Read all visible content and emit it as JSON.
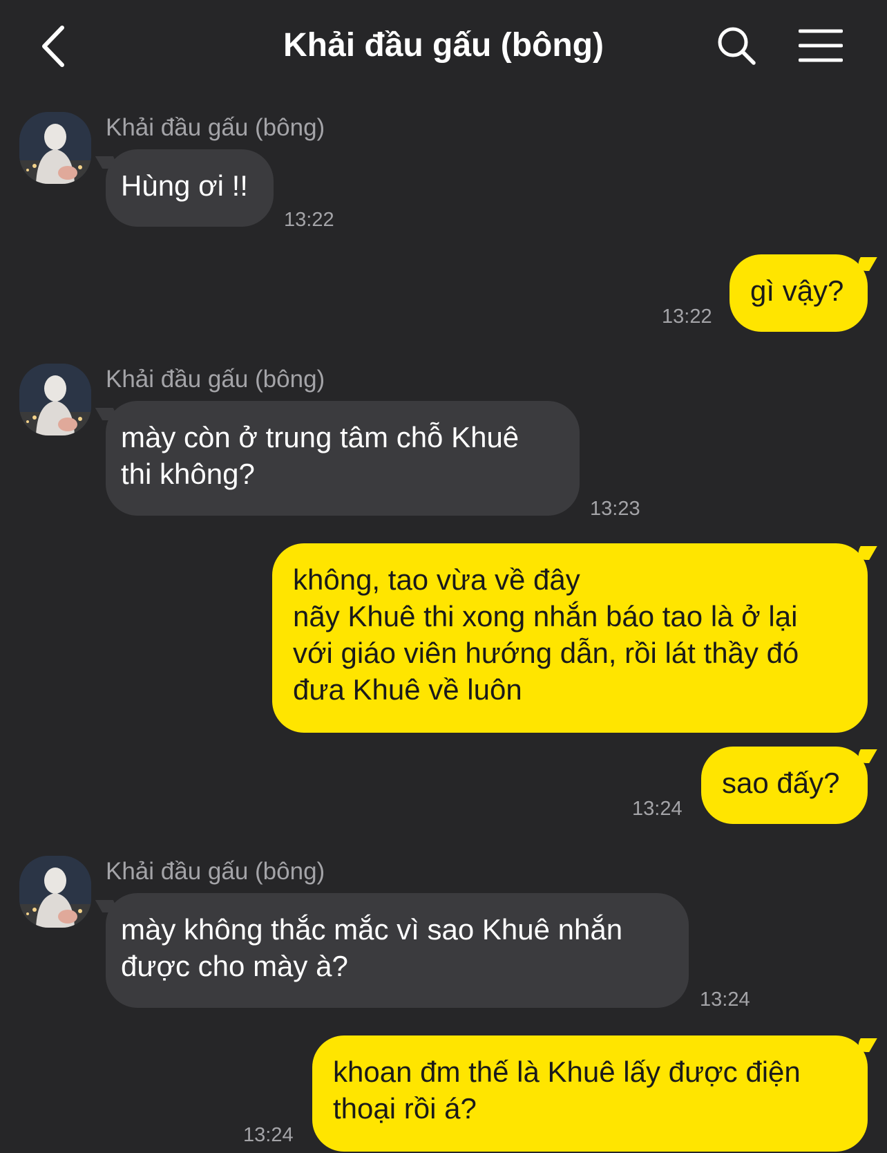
{
  "header": {
    "title": "Khải đầu gấu (bông)",
    "back_icon": "chevron-left-icon",
    "search_icon": "search-icon",
    "menu_icon": "hamburger-menu-icon"
  },
  "colors": {
    "background": "#262628",
    "incoming_bubble": "#3b3b3e",
    "outgoing_bubble": "#ffe500",
    "meta_text": "#a4a4a8"
  },
  "messages": [
    {
      "direction": "in",
      "sender": "Khải đầu gấu (bông)",
      "text": "Hùng ơi !!",
      "time": "13:22"
    },
    {
      "direction": "out",
      "text": "gì vậy?",
      "time": "13:22"
    },
    {
      "direction": "in",
      "sender": "Khải đầu gấu (bông)",
      "text": "mày còn ở trung tâm chỗ Khuê\nthi không?",
      "time": "13:23"
    },
    {
      "direction": "out",
      "text": "không, tao vừa về đây\nnãy Khuê thi xong nhắn báo tao là ở lại\nvới giáo viên hướng dẫn, rồi lát thầy đó\nđưa Khuê về luôn",
      "time": ""
    },
    {
      "direction": "out",
      "text": "sao đấy?",
      "time": "13:24"
    },
    {
      "direction": "in",
      "sender": "Khải đầu gấu (bông)",
      "text": "mày không thắc mắc vì sao Khuê nhắn\nđược cho mày à?",
      "time": "13:24"
    },
    {
      "direction": "out",
      "text": "khoan đm thế là Khuê lấy được điện\nthoại rồi á?",
      "time": "13:24"
    }
  ]
}
